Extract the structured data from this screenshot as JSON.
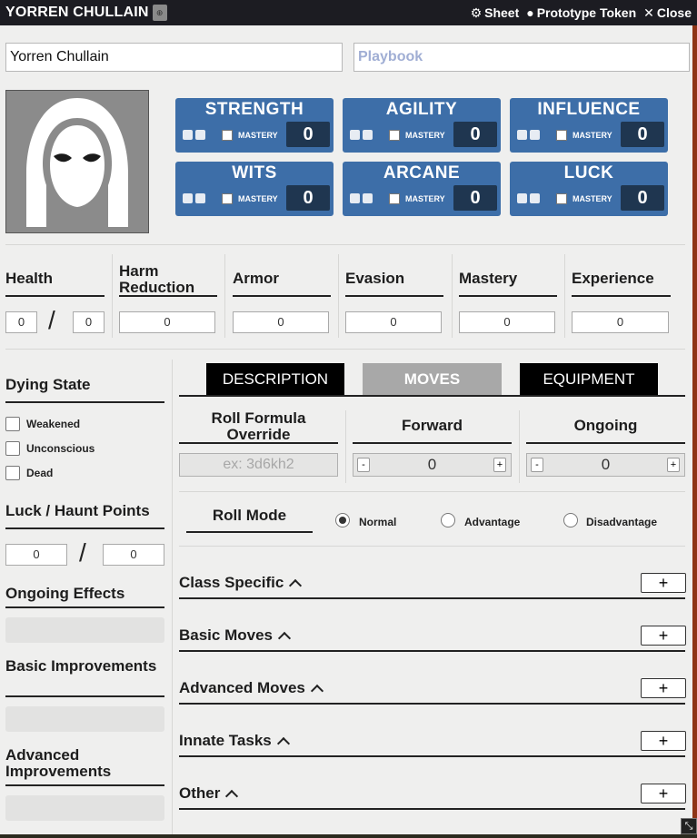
{
  "window": {
    "title": "YORREN CHULLAIN",
    "controls": {
      "sheet": "Sheet",
      "token": "Prototype Token",
      "close": "Close"
    }
  },
  "header": {
    "name": "Yorren Chullain",
    "playbook_placeholder": "Playbook"
  },
  "stats": [
    {
      "name": "STRENGTH",
      "mastery": "MASTERY",
      "value": "0"
    },
    {
      "name": "AGILITY",
      "mastery": "MASTERY",
      "value": "0"
    },
    {
      "name": "INFLUENCE",
      "mastery": "MASTERY",
      "value": "0"
    },
    {
      "name": "WITS",
      "mastery": "MASTERY",
      "value": "0"
    },
    {
      "name": "ARCANE",
      "mastery": "MASTERY",
      "value": "0"
    },
    {
      "name": "LUCK",
      "mastery": "MASTERY",
      "value": "0"
    }
  ],
  "attrs": {
    "health": "Health",
    "health_cur": "0",
    "health_max": "0",
    "harm_reduction": "Harm Reduction",
    "harm_value": "0",
    "armor": "Armor",
    "armor_value": "0",
    "evasion": "Evasion",
    "evasion_value": "0",
    "mastery": "Mastery",
    "mastery_value": "0",
    "experience": "Experience",
    "experience_value": "0"
  },
  "sidebar": {
    "dying_state": "Dying State",
    "dying_options": [
      "Weakened",
      "Unconscious",
      "Dead"
    ],
    "luck_haunt": "Luck / Haunt Points",
    "luck_value": "0",
    "haunt_value": "0",
    "ongoing_effects": "Ongoing Effects",
    "basic_improvements": "Basic Improvements",
    "advanced_improvements": "Advanced Improvements"
  },
  "tabs": [
    "DESCRIPTION",
    "MOVES",
    "EQUIPMENT"
  ],
  "moves": {
    "roll_formula": "Roll Formula Override",
    "roll_placeholder": "ex: 3d6kh2",
    "forward": "Forward",
    "forward_value": "0",
    "ongoing": "Ongoing",
    "ongoing_value": "0",
    "minus": "-",
    "plus": "+",
    "roll_mode": "Roll Mode",
    "modes": [
      "Normal",
      "Advantage",
      "Disadvantage"
    ],
    "sections": [
      "Class Specific",
      "Basic Moves",
      "Advanced Moves",
      "Innate Tasks",
      "Other"
    ],
    "add": "+"
  },
  "colors": {
    "stat_bg": "#3d6ea8",
    "stat_value_bg": "#1f3650",
    "tab_active": "#a8a8a8",
    "tab_inactive": "#000000"
  }
}
